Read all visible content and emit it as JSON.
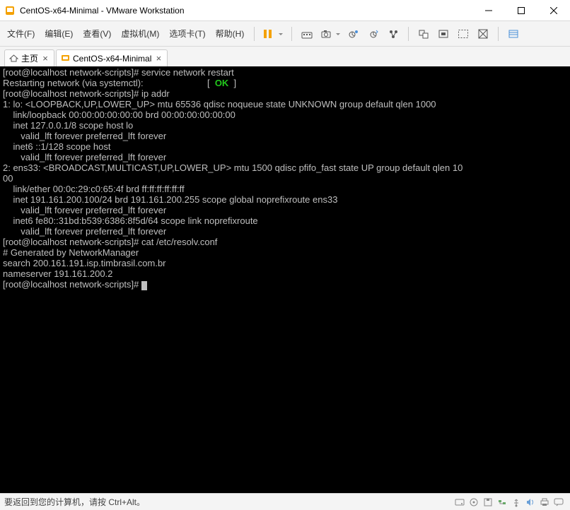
{
  "window": {
    "title": "CentOS-x64-Minimal - VMware Workstation"
  },
  "menubar": {
    "file": "文件(F)",
    "edit": "编辑(E)",
    "view": "查看(V)",
    "vm": "虚拟机(M)",
    "tabs": "选项卡(T)",
    "help": "帮助(H)"
  },
  "tabs": {
    "home": "主页",
    "vm": "CentOS-x64-Minimal"
  },
  "terminal": {
    "l1_prompt": "[root@localhost network-scripts]# ",
    "l1_cmd": "service network restart",
    "l2_a": "Restarting network (via systemctl):",
    "l2_pad": "                         [  ",
    "l2_ok": "OK",
    "l2_end": "  ]",
    "l3_prompt": "[root@localhost network-scripts]# ",
    "l3_cmd": "ip addr",
    "l4": "1: lo: <LOOPBACK,UP,LOWER_UP> mtu 65536 qdisc noqueue state UNKNOWN group default qlen 1000",
    "l5": "    link/loopback 00:00:00:00:00:00 brd 00:00:00:00:00:00",
    "l6": "    inet 127.0.0.1/8 scope host lo",
    "l7": "       valid_lft forever preferred_lft forever",
    "l8": "    inet6 ::1/128 scope host",
    "l9": "       valid_lft forever preferred_lft forever",
    "l10": "2: ens33: <BROADCAST,MULTICAST,UP,LOWER_UP> mtu 1500 qdisc pfifo_fast state UP group default qlen 10",
    "l10b": "00",
    "l11": "    link/ether 00:0c:29:c0:65:4f brd ff:ff:ff:ff:ff:ff",
    "l12": "    inet 191.161.200.100/24 brd 191.161.200.255 scope global noprefixroute ens33",
    "l13": "       valid_lft forever preferred_lft forever",
    "l14": "    inet6 fe80::31bd:b539:6386:8f5d/64 scope link noprefixroute",
    "l15": "       valid_lft forever preferred_lft forever",
    "l16_prompt": "[root@localhost network-scripts]# ",
    "l16_cmd": "cat /etc/resolv.conf",
    "l17": "# Generated by NetworkManager",
    "l18": "search 200.161.191.isp.timbrasil.com.br",
    "l19": "nameserver 191.161.200.2",
    "l20_prompt": "[root@localhost network-scripts]# "
  },
  "statusbar": {
    "text": "要返回到您的计算机，请按 Ctrl+Alt。"
  }
}
